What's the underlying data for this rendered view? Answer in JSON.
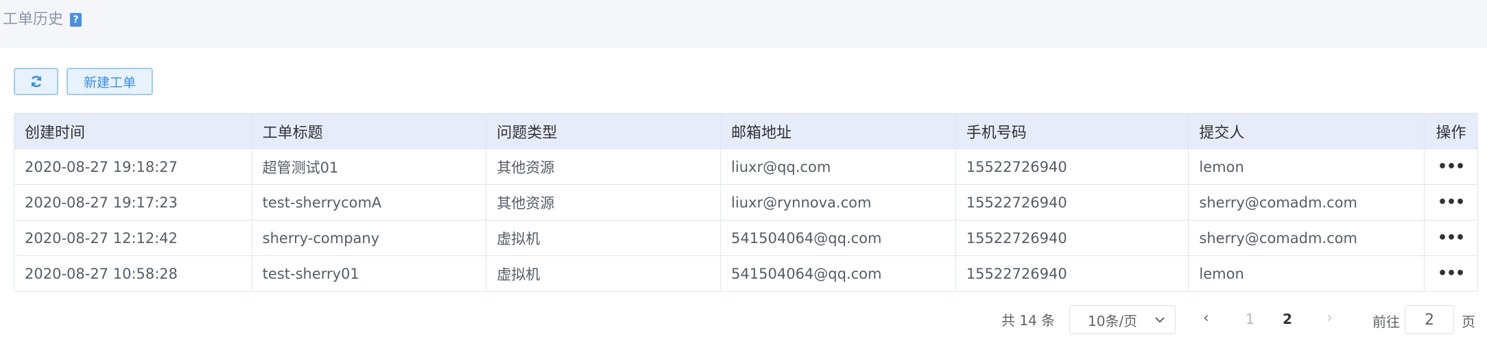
{
  "page": {
    "title": "工单历史",
    "help_icon": "?"
  },
  "toolbar": {
    "refresh_icon": "refresh-icon",
    "new_label": "新建工单"
  },
  "table": {
    "columns": [
      "创建时间",
      "工单标题",
      "问题类型",
      "邮箱地址",
      "手机号码",
      "提交人",
      "操作"
    ],
    "rows": [
      [
        "2020-08-27 19:18:27",
        "超管测试01",
        "其他资源",
        "liuxr@qq.com",
        "15522726940",
        "lemon",
        "•••"
      ],
      [
        "2020-08-27 19:17:23",
        "test-sherrycomA",
        "其他资源",
        "liuxr@rynnova.com",
        "15522726940",
        "sherry@comadm.com",
        "•••"
      ],
      [
        "2020-08-27 12:12:42",
        "sherry-company",
        "虚拟机",
        "541504064@qq.com",
        "15522726940",
        "sherry@comadm.com",
        "•••"
      ],
      [
        "2020-08-27 10:58:28",
        "test-sherry01",
        "虚拟机",
        "541504064@qq.com",
        "15522726940",
        "lemon",
        "•••"
      ]
    ]
  },
  "pagination": {
    "total": "共 14 条",
    "page_size": "10条/页",
    "pages": [
      "1",
      "2"
    ],
    "prev": "‹",
    "next": "›",
    "goto_label": "前往",
    "goto_value": "2",
    "goto_suffix": "页"
  },
  "colors": {
    "accent": "#3a8ee6",
    "header_bg": "#f5f6fa",
    "table_head_bg": "#e7ecfb"
  }
}
